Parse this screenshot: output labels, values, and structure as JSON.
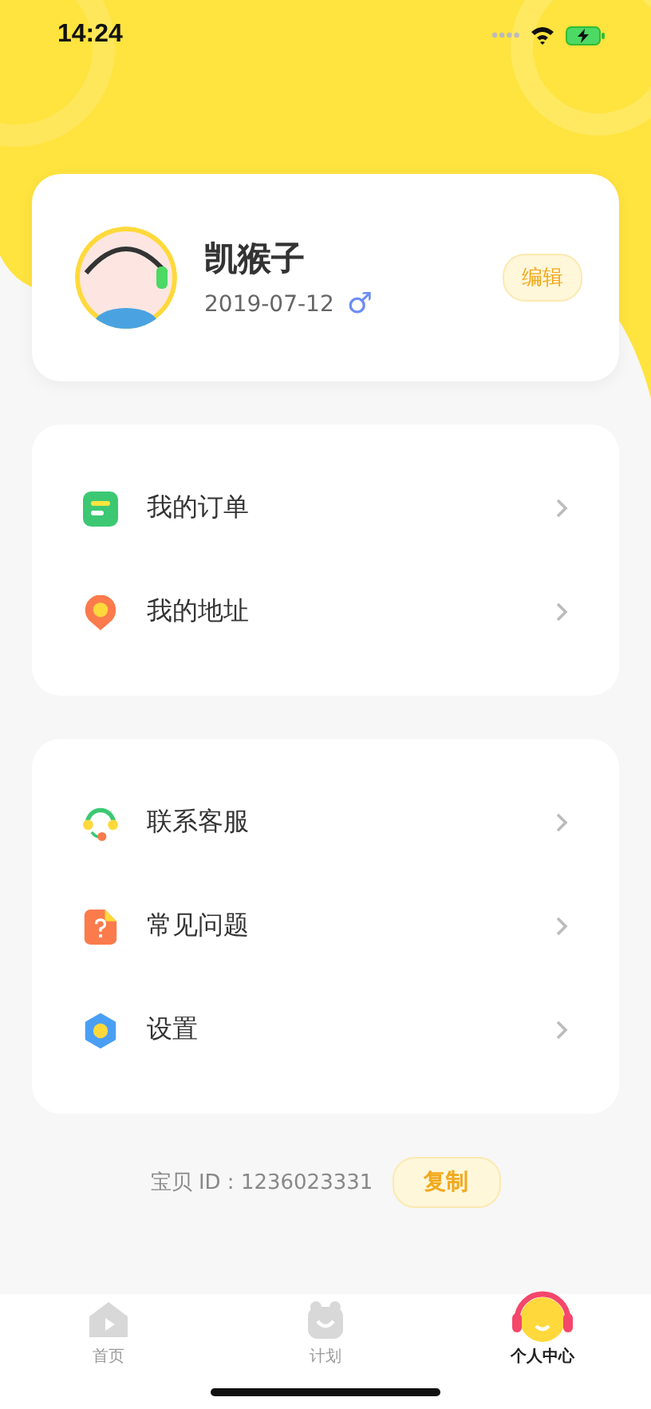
{
  "status_bar": {
    "time": "14:24"
  },
  "profile": {
    "name": "凯猴子",
    "birthday": "2019-07-12",
    "gender_symbol": "♂",
    "edit_button": "编辑"
  },
  "menu_groups": [
    {
      "items": [
        {
          "kind": "orders",
          "label": "我的订单"
        },
        {
          "kind": "address",
          "label": "我的地址"
        }
      ]
    },
    {
      "items": [
        {
          "kind": "service",
          "label": "联系客服"
        },
        {
          "kind": "faq",
          "label": "常见问题"
        },
        {
          "kind": "settings",
          "label": "设置"
        }
      ]
    }
  ],
  "baby_id": {
    "label": "宝贝 ID : 1236023331",
    "copy_button": "复制"
  },
  "tabs": [
    {
      "kind": "home",
      "label": "首页",
      "selected": false
    },
    {
      "kind": "plan",
      "label": "计划",
      "selected": false
    },
    {
      "kind": "profile",
      "label": "个人中心",
      "selected": true
    }
  ]
}
